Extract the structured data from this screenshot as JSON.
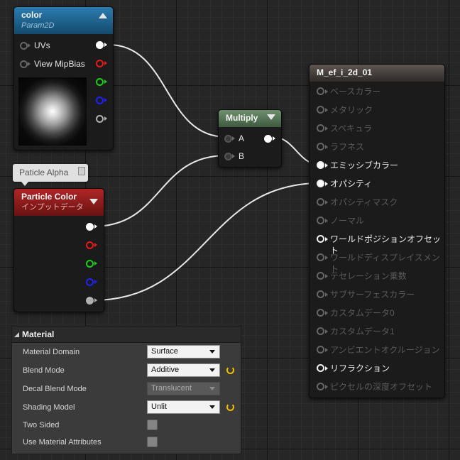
{
  "nodes": {
    "texture": {
      "title": "color",
      "subtitle": "Param2D",
      "header_color": "#1c5f8a",
      "inputs": [
        {
          "label": "UVs"
        },
        {
          "label": "View MipBias"
        }
      ],
      "outputs": [
        {
          "color": "#ffffff",
          "connected": true
        },
        {
          "color": "#e81818",
          "connected": false
        },
        {
          "color": "#18d018",
          "connected": false
        },
        {
          "color": "#2020ff",
          "connected": false
        },
        {
          "color": "#b0b0b0",
          "connected": false
        }
      ]
    },
    "comment": {
      "text": "Paticle Alpha"
    },
    "particle": {
      "title": "Particle Color",
      "subtitle": "インプットデータ",
      "header_color": "#8e1d1d",
      "outputs": [
        {
          "color": "#ffffff",
          "connected": true
        },
        {
          "color": "#e81818",
          "connected": false
        },
        {
          "color": "#18d018",
          "connected": false
        },
        {
          "color": "#2020ff",
          "connected": false
        },
        {
          "color": "#b0b0b0",
          "connected": true
        }
      ]
    },
    "multiply": {
      "title": "Multiply",
      "header_color": "#4d6b4d",
      "inputs": [
        {
          "label": "A"
        },
        {
          "label": "B"
        }
      ]
    },
    "material": {
      "title": "M_ef_i_2d_01",
      "pins": [
        {
          "label": "ベースカラー",
          "active": false
        },
        {
          "label": "メタリック",
          "active": false
        },
        {
          "label": "スペキュラ",
          "active": false
        },
        {
          "label": "ラフネス",
          "active": false
        },
        {
          "label": "エミッシブカラー",
          "active": true
        },
        {
          "label": "オパシティ",
          "active": true
        },
        {
          "label": "オパシティマスク",
          "active": false
        },
        {
          "label": "ノーマル",
          "active": false
        },
        {
          "label": "ワールドポジションオフセット",
          "active": true
        },
        {
          "label": "ワールドディスプレイスメント",
          "active": false
        },
        {
          "label": "テセレーション乗数",
          "active": false
        },
        {
          "label": "サブサーフェスカラー",
          "active": false
        },
        {
          "label": "カスタムデータ0",
          "active": false
        },
        {
          "label": "カスタムデータ1",
          "active": false
        },
        {
          "label": "アンビエントオクルージョン",
          "active": false
        },
        {
          "label": "リフラクション",
          "active": true
        },
        {
          "label": "ピクセルの深度オフセット",
          "active": false
        }
      ]
    }
  },
  "details": {
    "section_title": "Material",
    "properties": [
      {
        "label": "Material Domain",
        "value": "Surface",
        "type": "combo",
        "enabled": true,
        "reset": false
      },
      {
        "label": "Blend Mode",
        "value": "Additive",
        "type": "combo",
        "enabled": true,
        "reset": true
      },
      {
        "label": "Decal Blend Mode",
        "value": "Translucent",
        "type": "combo",
        "enabled": false,
        "reset": false
      },
      {
        "label": "Shading Model",
        "value": "Unlit",
        "type": "combo",
        "enabled": true,
        "reset": true
      },
      {
        "label": "Two Sided",
        "type": "checkbox",
        "checked": false
      },
      {
        "label": "Use Material Attributes",
        "type": "checkbox",
        "checked": false
      }
    ]
  }
}
